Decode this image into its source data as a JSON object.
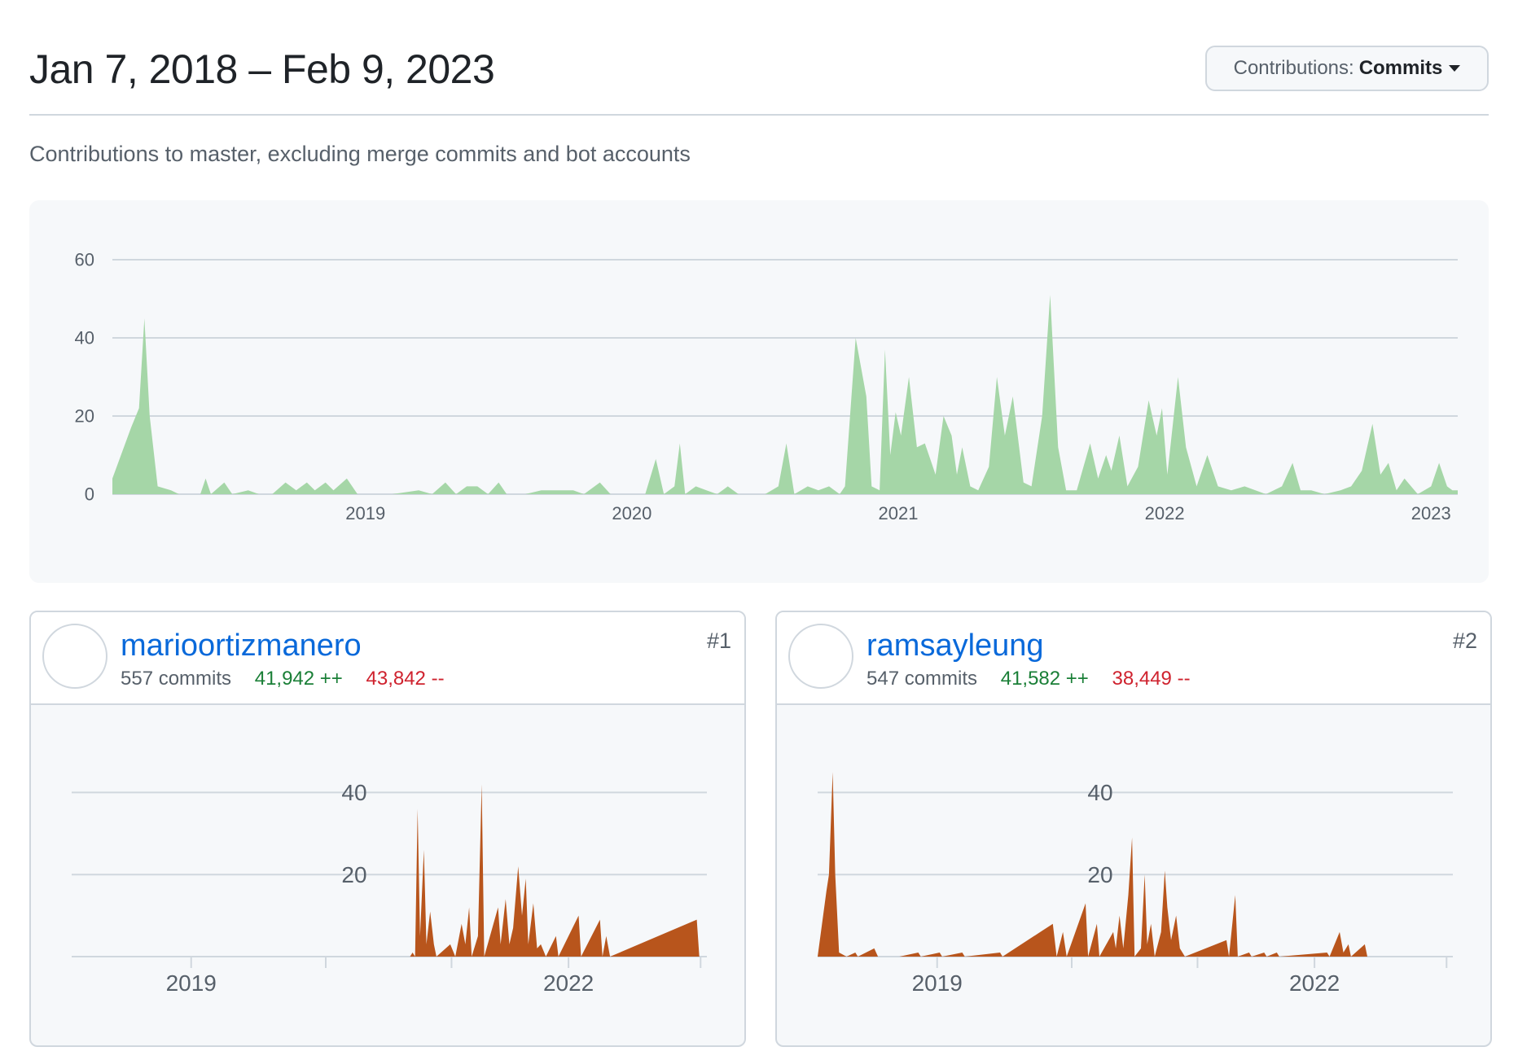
{
  "header": {
    "date_range": "Jan 7, 2018 – Feb 9, 2023",
    "contrib_label": "Contributions:",
    "contrib_value": "Commits"
  },
  "subtitle": "Contributions to master, excluding merge commits and bot accounts",
  "chart_data": [
    {
      "type": "area",
      "series_color": "#a5d6a7",
      "yticks": [
        0,
        20,
        40,
        60
      ],
      "ylim": [
        0,
        60
      ],
      "xlim": [
        2018.05,
        2023.1
      ],
      "xticks": [
        "2019",
        "2020",
        "2021",
        "2022",
        "2023"
      ],
      "grid": true,
      "points": [
        [
          2018.05,
          4
        ],
        [
          2018.12,
          17
        ],
        [
          2018.15,
          22
        ],
        [
          2018.17,
          45
        ],
        [
          2018.19,
          20
        ],
        [
          2018.22,
          2
        ],
        [
          2018.27,
          1
        ],
        [
          2018.3,
          0
        ],
        [
          2018.38,
          0
        ],
        [
          2018.4,
          4
        ],
        [
          2018.42,
          0
        ],
        [
          2018.47,
          3
        ],
        [
          2018.5,
          0
        ],
        [
          2018.56,
          1
        ],
        [
          2018.6,
          0
        ],
        [
          2018.65,
          0
        ],
        [
          2018.7,
          3
        ],
        [
          2018.74,
          1
        ],
        [
          2018.78,
          3
        ],
        [
          2018.81,
          1
        ],
        [
          2018.85,
          3
        ],
        [
          2018.88,
          1
        ],
        [
          2018.93,
          4
        ],
        [
          2018.97,
          0
        ],
        [
          2019.05,
          0
        ],
        [
          2019.1,
          0
        ],
        [
          2019.2,
          1
        ],
        [
          2019.25,
          0
        ],
        [
          2019.3,
          3
        ],
        [
          2019.34,
          0
        ],
        [
          2019.38,
          2
        ],
        [
          2019.42,
          2
        ],
        [
          2019.46,
          0
        ],
        [
          2019.5,
          3
        ],
        [
          2019.53,
          0
        ],
        [
          2019.6,
          0
        ],
        [
          2019.66,
          1
        ],
        [
          2019.72,
          1
        ],
        [
          2019.78,
          1
        ],
        [
          2019.82,
          0
        ],
        [
          2019.88,
          3
        ],
        [
          2019.92,
          0
        ],
        [
          2020.0,
          0
        ],
        [
          2020.05,
          0
        ],
        [
          2020.09,
          9
        ],
        [
          2020.12,
          0
        ],
        [
          2020.16,
          2
        ],
        [
          2020.18,
          13
        ],
        [
          2020.2,
          0
        ],
        [
          2020.24,
          2
        ],
        [
          2020.28,
          1
        ],
        [
          2020.32,
          0
        ],
        [
          2020.36,
          2
        ],
        [
          2020.4,
          0
        ],
        [
          2020.5,
          0
        ],
        [
          2020.55,
          2
        ],
        [
          2020.58,
          13
        ],
        [
          2020.61,
          0
        ],
        [
          2020.66,
          2
        ],
        [
          2020.7,
          1
        ],
        [
          2020.74,
          2
        ],
        [
          2020.78,
          0
        ],
        [
          2020.8,
          2
        ],
        [
          2020.84,
          40
        ],
        [
          2020.88,
          25
        ],
        [
          2020.9,
          2
        ],
        [
          2020.93,
          1
        ],
        [
          2020.95,
          37
        ],
        [
          2020.97,
          10
        ],
        [
          2020.99,
          21
        ],
        [
          2021.01,
          15
        ],
        [
          2021.04,
          30
        ],
        [
          2021.07,
          12
        ],
        [
          2021.1,
          13
        ],
        [
          2021.14,
          5
        ],
        [
          2021.17,
          20
        ],
        [
          2021.2,
          15
        ],
        [
          2021.22,
          5
        ],
        [
          2021.24,
          12
        ],
        [
          2021.27,
          2
        ],
        [
          2021.3,
          1
        ],
        [
          2021.34,
          7
        ],
        [
          2021.37,
          30
        ],
        [
          2021.4,
          15
        ],
        [
          2021.43,
          25
        ],
        [
          2021.47,
          3
        ],
        [
          2021.5,
          2
        ],
        [
          2021.54,
          20
        ],
        [
          2021.57,
          51
        ],
        [
          2021.6,
          12
        ],
        [
          2021.63,
          1
        ],
        [
          2021.67,
          1
        ],
        [
          2021.72,
          13
        ],
        [
          2021.75,
          4
        ],
        [
          2021.78,
          10
        ],
        [
          2021.8,
          6
        ],
        [
          2021.83,
          15
        ],
        [
          2021.86,
          2
        ],
        [
          2021.9,
          7
        ],
        [
          2021.94,
          24
        ],
        [
          2021.97,
          15
        ],
        [
          2021.99,
          22
        ],
        [
          2022.01,
          5
        ],
        [
          2022.05,
          30
        ],
        [
          2022.08,
          12
        ],
        [
          2022.12,
          2
        ],
        [
          2022.16,
          10
        ],
        [
          2022.2,
          2
        ],
        [
          2022.25,
          1
        ],
        [
          2022.3,
          2
        ],
        [
          2022.38,
          0
        ],
        [
          2022.44,
          2
        ],
        [
          2022.48,
          8
        ],
        [
          2022.51,
          1
        ],
        [
          2022.55,
          1
        ],
        [
          2022.6,
          0
        ],
        [
          2022.66,
          1
        ],
        [
          2022.7,
          2
        ],
        [
          2022.74,
          6
        ],
        [
          2022.78,
          18
        ],
        [
          2022.81,
          5
        ],
        [
          2022.84,
          8
        ],
        [
          2022.87,
          1
        ],
        [
          2022.9,
          4
        ],
        [
          2022.95,
          0
        ],
        [
          2023.0,
          2
        ],
        [
          2023.03,
          8
        ],
        [
          2023.06,
          2
        ],
        [
          2023.08,
          1
        ],
        [
          2023.1,
          1
        ]
      ]
    },
    {
      "type": "area",
      "series_color": "#b8551c",
      "yticks": [
        20,
        40
      ],
      "xticks": [
        "2019",
        "2022"
      ],
      "points": [
        [
          2018.05,
          0
        ],
        [
          2020.74,
          0
        ],
        [
          2020.76,
          1
        ],
        [
          2020.78,
          0
        ],
        [
          2020.8,
          36
        ],
        [
          2020.82,
          5
        ],
        [
          2020.85,
          26
        ],
        [
          2020.87,
          3
        ],
        [
          2020.9,
          11
        ],
        [
          2020.93,
          3
        ],
        [
          2020.95,
          0
        ],
        [
          2021.06,
          3
        ],
        [
          2021.1,
          0
        ],
        [
          2021.15,
          8
        ],
        [
          2021.18,
          3
        ],
        [
          2021.21,
          12
        ],
        [
          2021.23,
          0
        ],
        [
          2021.28,
          5
        ],
        [
          2021.31,
          42
        ],
        [
          2021.33,
          0
        ],
        [
          2021.44,
          12
        ],
        [
          2021.46,
          3
        ],
        [
          2021.5,
          14
        ],
        [
          2021.53,
          3
        ],
        [
          2021.56,
          7
        ],
        [
          2021.6,
          22
        ],
        [
          2021.63,
          10
        ],
        [
          2021.66,
          19
        ],
        [
          2021.68,
          3
        ],
        [
          2021.72,
          13
        ],
        [
          2021.75,
          2
        ],
        [
          2021.78,
          3
        ],
        [
          2021.82,
          0
        ],
        [
          2021.9,
          5
        ],
        [
          2021.92,
          0
        ],
        [
          2022.08,
          10
        ],
        [
          2022.1,
          0
        ],
        [
          2022.25,
          9
        ],
        [
          2022.27,
          0
        ],
        [
          2022.3,
          5
        ],
        [
          2022.33,
          0
        ],
        [
          2023.02,
          9
        ],
        [
          2023.04,
          0
        ]
      ]
    },
    {
      "type": "area",
      "series_color": "#b8551c",
      "yticks": [
        20,
        40
      ],
      "xticks": [
        "2019",
        "2022"
      ],
      "points": [
        [
          2018.05,
          0
        ],
        [
          2018.12,
          16
        ],
        [
          2018.14,
          20
        ],
        [
          2018.17,
          45
        ],
        [
          2018.19,
          20
        ],
        [
          2018.22,
          1
        ],
        [
          2018.28,
          0
        ],
        [
          2018.35,
          1
        ],
        [
          2018.37,
          0
        ],
        [
          2018.5,
          2
        ],
        [
          2018.53,
          0
        ],
        [
          2018.7,
          0
        ],
        [
          2018.85,
          1
        ],
        [
          2018.87,
          0
        ],
        [
          2019.02,
          1
        ],
        [
          2019.04,
          0
        ],
        [
          2019.2,
          1
        ],
        [
          2019.22,
          0
        ],
        [
          2019.5,
          1
        ],
        [
          2019.52,
          0
        ],
        [
          2019.92,
          8
        ],
        [
          2019.95,
          0
        ],
        [
          2020.0,
          6
        ],
        [
          2020.03,
          0
        ],
        [
          2020.18,
          13
        ],
        [
          2020.2,
          0
        ],
        [
          2020.27,
          8
        ],
        [
          2020.29,
          0
        ],
        [
          2020.4,
          6
        ],
        [
          2020.42,
          2
        ],
        [
          2020.45,
          10
        ],
        [
          2020.48,
          2
        ],
        [
          2020.52,
          15
        ],
        [
          2020.55,
          29
        ],
        [
          2020.57,
          0
        ],
        [
          2020.62,
          2
        ],
        [
          2020.65,
          20
        ],
        [
          2020.67,
          3
        ],
        [
          2020.7,
          8
        ],
        [
          2020.73,
          0
        ],
        [
          2020.78,
          6
        ],
        [
          2020.81,
          21
        ],
        [
          2020.83,
          12
        ],
        [
          2020.86,
          4
        ],
        [
          2020.9,
          10
        ],
        [
          2020.93,
          2
        ],
        [
          2020.97,
          0
        ],
        [
          2021.3,
          4
        ],
        [
          2021.32,
          0
        ],
        [
          2021.37,
          15
        ],
        [
          2021.39,
          0
        ],
        [
          2021.48,
          1
        ],
        [
          2021.5,
          0
        ],
        [
          2021.6,
          1
        ],
        [
          2021.62,
          0
        ],
        [
          2021.7,
          1
        ],
        [
          2021.72,
          0
        ],
        [
          2022.1,
          1
        ],
        [
          2022.12,
          0
        ],
        [
          2022.2,
          6
        ],
        [
          2022.23,
          1
        ],
        [
          2022.27,
          3
        ],
        [
          2022.29,
          0
        ],
        [
          2022.4,
          3
        ],
        [
          2022.42,
          0
        ]
      ]
    }
  ],
  "contributors": [
    {
      "username": "marioortizmanero",
      "commits": "557 commits",
      "additions": "41,942 ++",
      "deletions": "43,842 --",
      "rank": "#1",
      "avatar_icon": "person-photo-icon"
    },
    {
      "username": "ramsayleung",
      "commits": "547 commits",
      "additions": "41,582 ++",
      "deletions": "38,449 --",
      "rank": "#2",
      "avatar_icon": "pixel-art-avatar-icon"
    }
  ]
}
